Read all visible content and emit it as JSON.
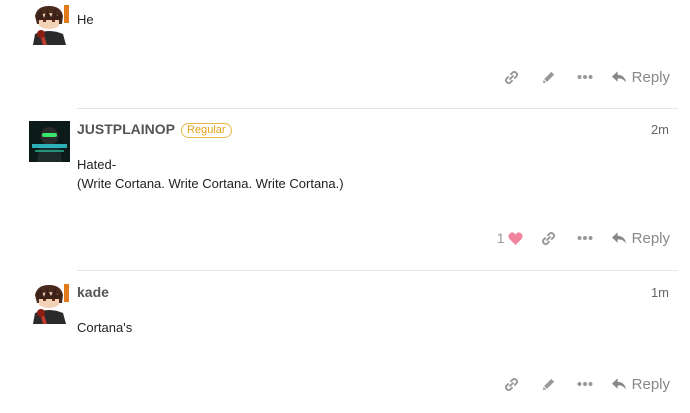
{
  "posts": [
    {
      "author": "",
      "body": [
        "He"
      ],
      "actions": {
        "reply_label": "Reply"
      }
    },
    {
      "author": "JUSTPLAINOP",
      "badge": "Regular",
      "time": "2m",
      "body": [
        "Hated-",
        "(Write Cortana. Write Cortana. Write Cortana.)"
      ],
      "actions": {
        "like_count": "1",
        "reply_label": "Reply"
      }
    },
    {
      "author": "kade",
      "time": "1m",
      "body": [
        "Cortana's"
      ],
      "actions": {
        "reply_label": "Reply"
      }
    }
  ],
  "colors": {
    "heart": "#f2849c",
    "badge": "#e8a21a",
    "icon": "#999999"
  },
  "icons": [
    "link-icon",
    "pencil-icon",
    "more-icon",
    "reply-arrow-icon",
    "heart-icon"
  ]
}
